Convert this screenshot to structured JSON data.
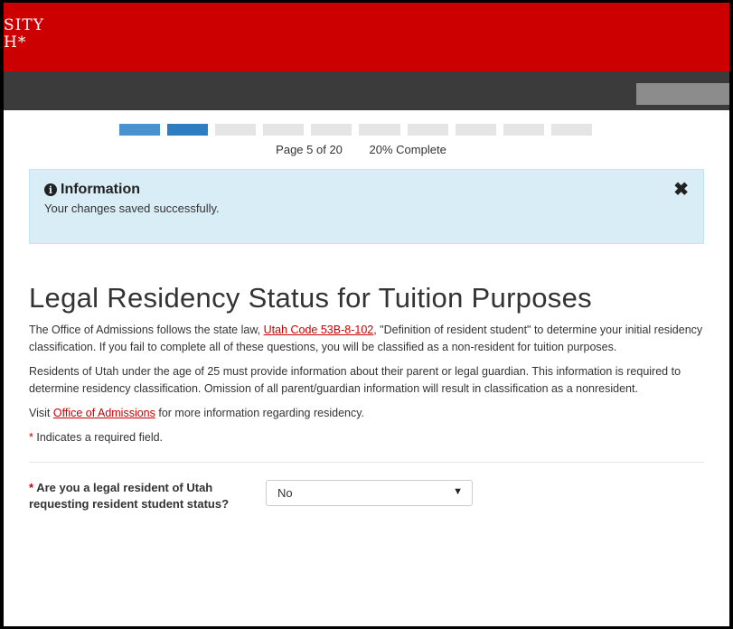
{
  "header": {
    "logo_line1": "SITY",
    "logo_line2": "H*"
  },
  "progress": {
    "completed_fraction": 0.2,
    "page_label": "Page 5 of 20",
    "percent_label": "20% Complete"
  },
  "alert": {
    "title": "Information",
    "message": "Your changes saved successfully.",
    "close_glyph": "✖"
  },
  "page": {
    "title": "Legal Residency Status for Tuition Purposes",
    "p1_before": "The Office of Admissions follows the state law, ",
    "p1_link": "Utah Code 53B-8-102",
    "p1_after": ", \"Definition of resident student\" to determine your initial residency classification. If you fail to complete all of these questions, you will be classified as a non-resident for tuition purposes.",
    "p2": "Residents of Utah under the age of 25 must provide information about their parent or legal guardian. This information is required to determine residency classification. Omission of all parent/guardian information will result in classification as a nonresident.",
    "p3_before": "Visit ",
    "p3_link": "Office of Admissions",
    "p3_after": " for more information regarding residency.",
    "required_star": "*",
    "required_note": " Indicates a required field."
  },
  "question": {
    "star": "*",
    "label": " Are you a legal resident of Utah requesting resident student status?",
    "selected": "No",
    "caret": "▼"
  },
  "colors": {
    "brand": "#cc0000",
    "nav": "#3b3b3b",
    "progress_done": "#2d7dc0",
    "alert_bg": "#d9edf7"
  }
}
